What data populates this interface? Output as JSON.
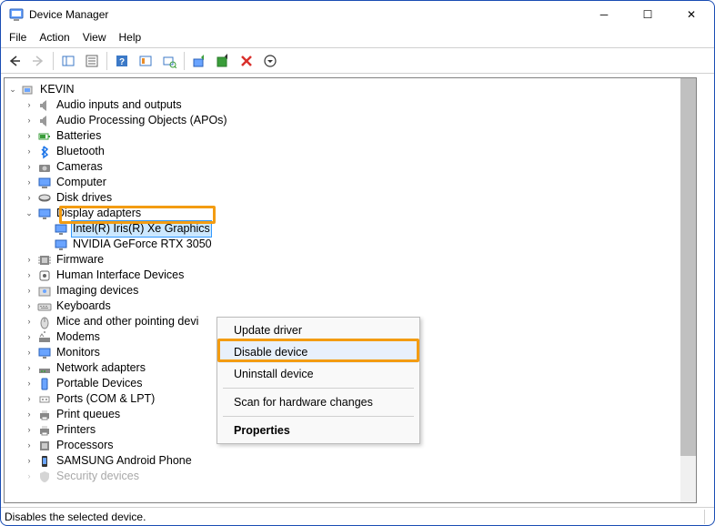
{
  "title": "Device Manager",
  "menu": {
    "file": "File",
    "action": "Action",
    "view": "View",
    "help": "Help"
  },
  "root_name": "KEVIN",
  "nodes": [
    {
      "label": "Audio inputs and outputs",
      "icon": "speaker"
    },
    {
      "label": "Audio Processing Objects (APOs)",
      "icon": "speaker"
    },
    {
      "label": "Batteries",
      "icon": "battery"
    },
    {
      "label": "Bluetooth",
      "icon": "bluetooth"
    },
    {
      "label": "Cameras",
      "icon": "camera"
    },
    {
      "label": "Computer",
      "icon": "computer"
    },
    {
      "label": "Disk drives",
      "icon": "disk"
    },
    {
      "label": "Display adapters",
      "icon": "display",
      "expanded": true,
      "children": [
        {
          "label": "Intel(R) Iris(R) Xe Graphics",
          "icon": "display",
          "selected": true
        },
        {
          "label": "NVIDIA GeForce RTX 3050",
          "icon": "display"
        }
      ]
    },
    {
      "label": "Firmware",
      "icon": "chip"
    },
    {
      "label": "Human Interface Devices",
      "icon": "hid"
    },
    {
      "label": "Imaging devices",
      "icon": "imaging"
    },
    {
      "label": "Keyboards",
      "icon": "keyboard"
    },
    {
      "label": "Mice and other pointing devi",
      "icon": "mouse",
      "clipped": true
    },
    {
      "label": "Modems",
      "icon": "modem"
    },
    {
      "label": "Monitors",
      "icon": "monitor"
    },
    {
      "label": "Network adapters",
      "icon": "network"
    },
    {
      "label": "Portable Devices",
      "icon": "portable"
    },
    {
      "label": "Ports (COM & LPT)",
      "icon": "port"
    },
    {
      "label": "Print queues",
      "icon": "printer"
    },
    {
      "label": "Printers",
      "icon": "printer"
    },
    {
      "label": "Processors",
      "icon": "cpu"
    },
    {
      "label": "SAMSUNG Android Phone",
      "icon": "phone"
    },
    {
      "label": "Security devices",
      "icon": "security",
      "faded": true
    }
  ],
  "context_menu": {
    "items": [
      {
        "label": "Update driver"
      },
      {
        "label": "Disable device",
        "hovered": true
      },
      {
        "label": "Uninstall device"
      }
    ],
    "scan_label": "Scan for hardware changes",
    "properties_label": "Properties"
  },
  "statusbar_text": "Disables the selected device."
}
